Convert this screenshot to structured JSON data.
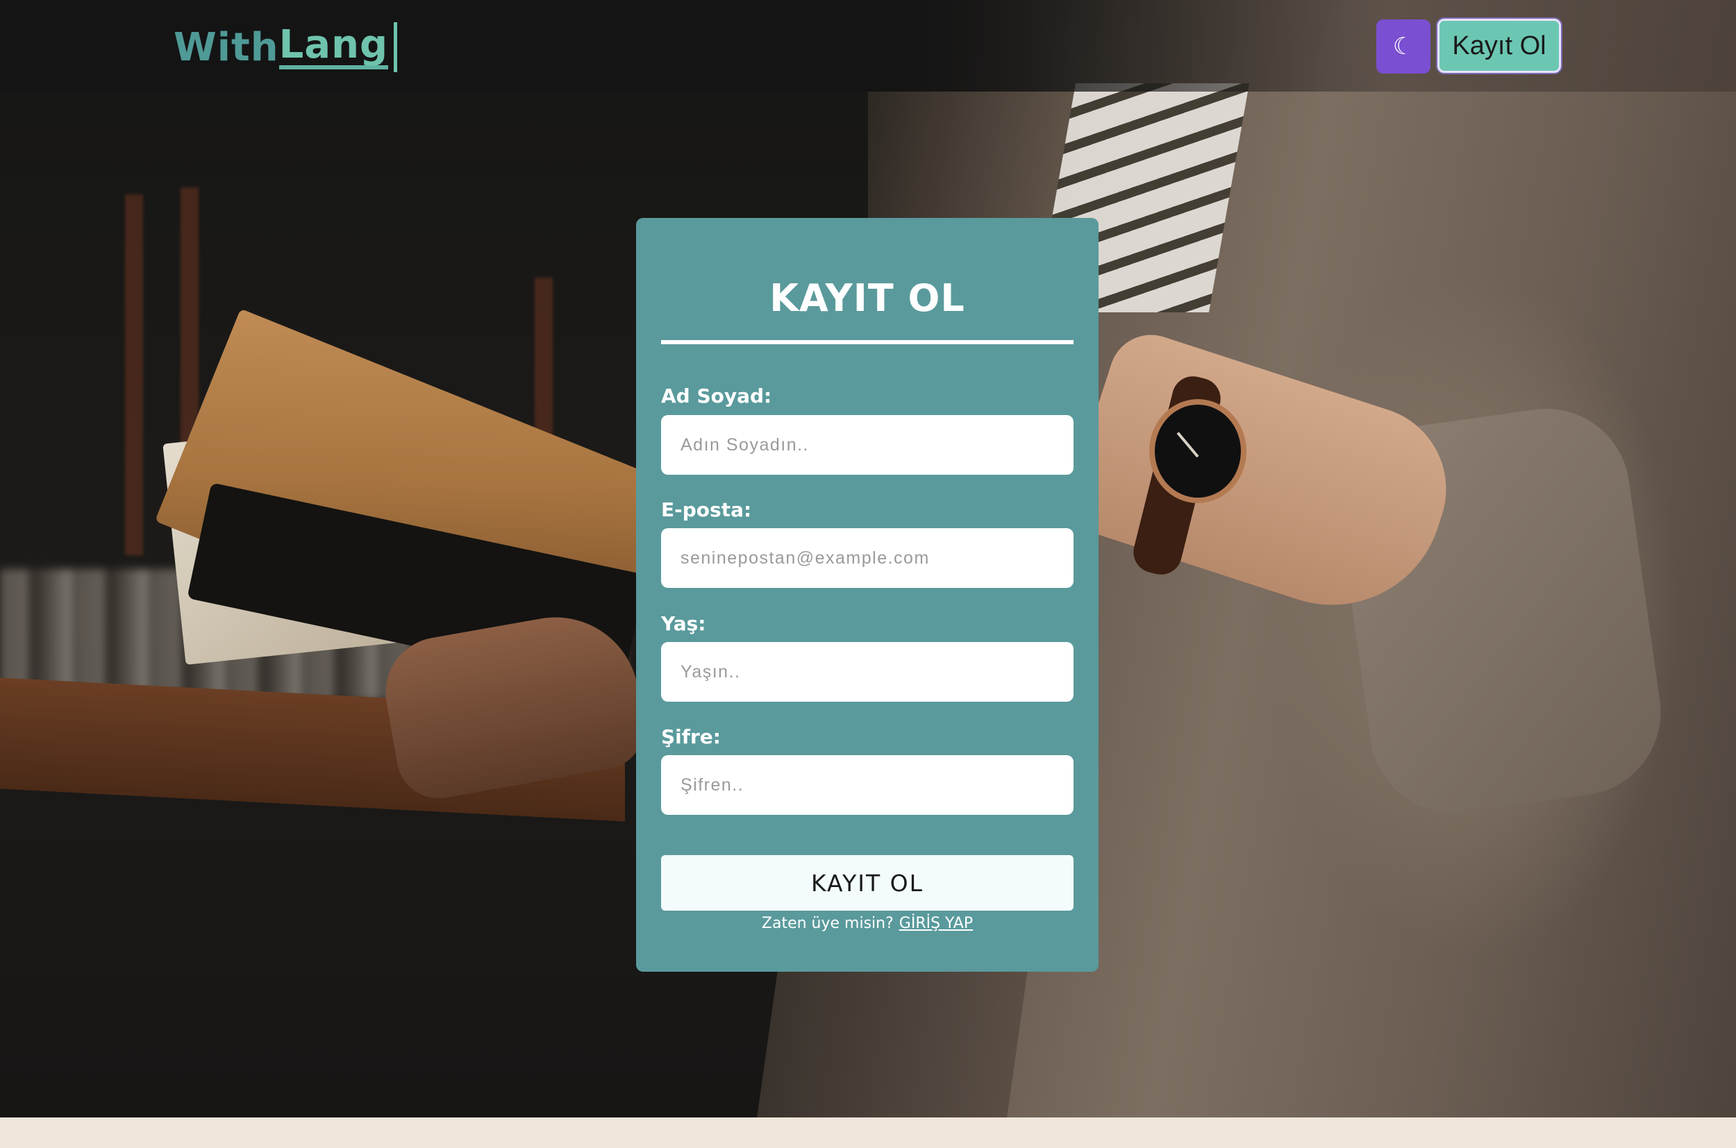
{
  "navbar": {
    "logo_part1": "With",
    "logo_part2": "Lang",
    "theme_icon": "moon-icon",
    "theme_glyph": "☾",
    "register_label": "Kayıt Ol"
  },
  "form": {
    "title": "KAYIT OL",
    "fields": [
      {
        "label": "Ad Soyad:",
        "placeholder": "Adın Soyadın..",
        "value": ""
      },
      {
        "label": "E-posta:",
        "placeholder": "seninepostan@example.com",
        "value": ""
      },
      {
        "label": "Yaş:",
        "placeholder": "Yaşın..",
        "value": ""
      },
      {
        "label": "Şifre:",
        "placeholder": "Şifren..",
        "value": ""
      }
    ],
    "submit_label": "KAYIT OL",
    "login_prompt": "Zaten üye misin?",
    "login_link": "GİRİŞ YAP"
  },
  "colors": {
    "card": "#5a9a9c",
    "theme_button": "#7b4fd1",
    "register_button": "#6cc7b2",
    "logo_primary": "#4f9a97",
    "logo_secondary": "#6fc3ad",
    "footer_strip": "#f0e6dc"
  }
}
